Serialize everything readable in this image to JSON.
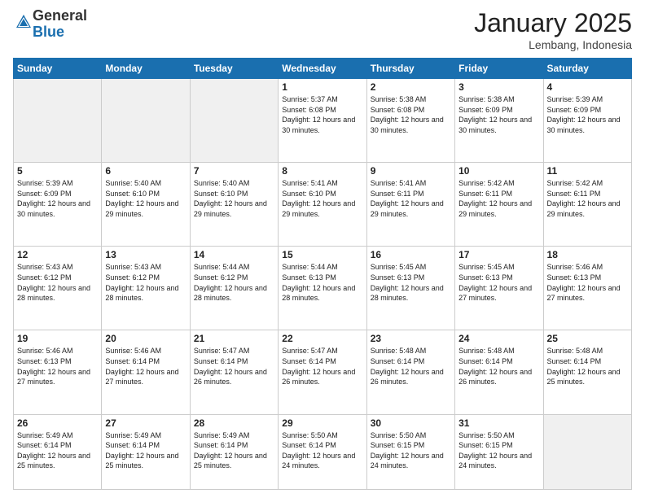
{
  "header": {
    "logo_general": "General",
    "logo_blue": "Blue",
    "month_title": "January 2025",
    "location": "Lembang, Indonesia"
  },
  "days_of_week": [
    "Sunday",
    "Monday",
    "Tuesday",
    "Wednesday",
    "Thursday",
    "Friday",
    "Saturday"
  ],
  "weeks": [
    [
      {
        "num": "",
        "info": ""
      },
      {
        "num": "",
        "info": ""
      },
      {
        "num": "",
        "info": ""
      },
      {
        "num": "1",
        "info": "Sunrise: 5:37 AM\nSunset: 6:08 PM\nDaylight: 12 hours and 30 minutes."
      },
      {
        "num": "2",
        "info": "Sunrise: 5:38 AM\nSunset: 6:08 PM\nDaylight: 12 hours and 30 minutes."
      },
      {
        "num": "3",
        "info": "Sunrise: 5:38 AM\nSunset: 6:09 PM\nDaylight: 12 hours and 30 minutes."
      },
      {
        "num": "4",
        "info": "Sunrise: 5:39 AM\nSunset: 6:09 PM\nDaylight: 12 hours and 30 minutes."
      }
    ],
    [
      {
        "num": "5",
        "info": "Sunrise: 5:39 AM\nSunset: 6:09 PM\nDaylight: 12 hours and 30 minutes."
      },
      {
        "num": "6",
        "info": "Sunrise: 5:40 AM\nSunset: 6:10 PM\nDaylight: 12 hours and 29 minutes."
      },
      {
        "num": "7",
        "info": "Sunrise: 5:40 AM\nSunset: 6:10 PM\nDaylight: 12 hours and 29 minutes."
      },
      {
        "num": "8",
        "info": "Sunrise: 5:41 AM\nSunset: 6:10 PM\nDaylight: 12 hours and 29 minutes."
      },
      {
        "num": "9",
        "info": "Sunrise: 5:41 AM\nSunset: 6:11 PM\nDaylight: 12 hours and 29 minutes."
      },
      {
        "num": "10",
        "info": "Sunrise: 5:42 AM\nSunset: 6:11 PM\nDaylight: 12 hours and 29 minutes."
      },
      {
        "num": "11",
        "info": "Sunrise: 5:42 AM\nSunset: 6:11 PM\nDaylight: 12 hours and 29 minutes."
      }
    ],
    [
      {
        "num": "12",
        "info": "Sunrise: 5:43 AM\nSunset: 6:12 PM\nDaylight: 12 hours and 28 minutes."
      },
      {
        "num": "13",
        "info": "Sunrise: 5:43 AM\nSunset: 6:12 PM\nDaylight: 12 hours and 28 minutes."
      },
      {
        "num": "14",
        "info": "Sunrise: 5:44 AM\nSunset: 6:12 PM\nDaylight: 12 hours and 28 minutes."
      },
      {
        "num": "15",
        "info": "Sunrise: 5:44 AM\nSunset: 6:13 PM\nDaylight: 12 hours and 28 minutes."
      },
      {
        "num": "16",
        "info": "Sunrise: 5:45 AM\nSunset: 6:13 PM\nDaylight: 12 hours and 28 minutes."
      },
      {
        "num": "17",
        "info": "Sunrise: 5:45 AM\nSunset: 6:13 PM\nDaylight: 12 hours and 27 minutes."
      },
      {
        "num": "18",
        "info": "Sunrise: 5:46 AM\nSunset: 6:13 PM\nDaylight: 12 hours and 27 minutes."
      }
    ],
    [
      {
        "num": "19",
        "info": "Sunrise: 5:46 AM\nSunset: 6:13 PM\nDaylight: 12 hours and 27 minutes."
      },
      {
        "num": "20",
        "info": "Sunrise: 5:46 AM\nSunset: 6:14 PM\nDaylight: 12 hours and 27 minutes."
      },
      {
        "num": "21",
        "info": "Sunrise: 5:47 AM\nSunset: 6:14 PM\nDaylight: 12 hours and 26 minutes."
      },
      {
        "num": "22",
        "info": "Sunrise: 5:47 AM\nSunset: 6:14 PM\nDaylight: 12 hours and 26 minutes."
      },
      {
        "num": "23",
        "info": "Sunrise: 5:48 AM\nSunset: 6:14 PM\nDaylight: 12 hours and 26 minutes."
      },
      {
        "num": "24",
        "info": "Sunrise: 5:48 AM\nSunset: 6:14 PM\nDaylight: 12 hours and 26 minutes."
      },
      {
        "num": "25",
        "info": "Sunrise: 5:48 AM\nSunset: 6:14 PM\nDaylight: 12 hours and 25 minutes."
      }
    ],
    [
      {
        "num": "26",
        "info": "Sunrise: 5:49 AM\nSunset: 6:14 PM\nDaylight: 12 hours and 25 minutes."
      },
      {
        "num": "27",
        "info": "Sunrise: 5:49 AM\nSunset: 6:14 PM\nDaylight: 12 hours and 25 minutes."
      },
      {
        "num": "28",
        "info": "Sunrise: 5:49 AM\nSunset: 6:14 PM\nDaylight: 12 hours and 25 minutes."
      },
      {
        "num": "29",
        "info": "Sunrise: 5:50 AM\nSunset: 6:14 PM\nDaylight: 12 hours and 24 minutes."
      },
      {
        "num": "30",
        "info": "Sunrise: 5:50 AM\nSunset: 6:15 PM\nDaylight: 12 hours and 24 minutes."
      },
      {
        "num": "31",
        "info": "Sunrise: 5:50 AM\nSunset: 6:15 PM\nDaylight: 12 hours and 24 minutes."
      },
      {
        "num": "",
        "info": ""
      }
    ]
  ],
  "empty_cells_week1": [
    0,
    1,
    2
  ],
  "empty_cells_week5": [
    6
  ]
}
